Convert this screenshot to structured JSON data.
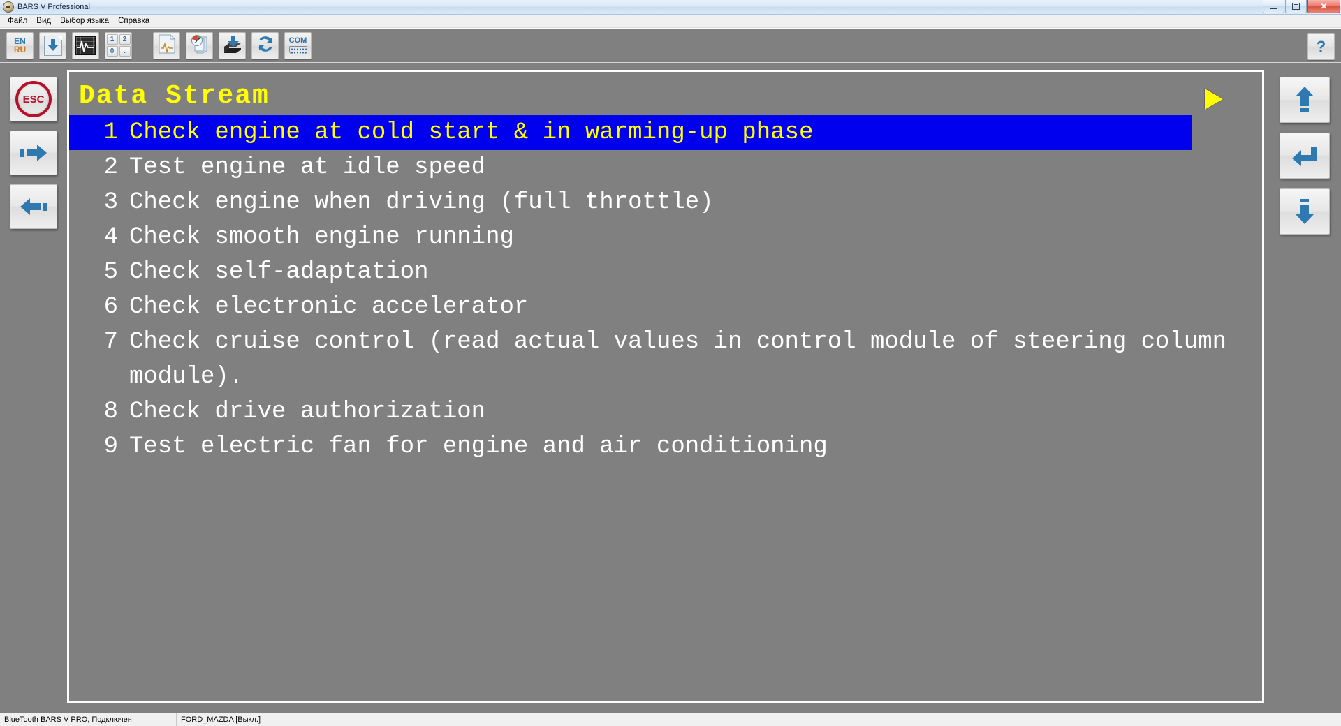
{
  "window": {
    "title": "BARS V Professional",
    "icon": "app-icon",
    "controls": [
      {
        "name": "minimize-button",
        "glyph": "minimize-icon"
      },
      {
        "name": "restore-button",
        "glyph": "restore-icon"
      },
      {
        "name": "close-button",
        "glyph": "close-icon",
        "label": "✕"
      }
    ]
  },
  "menu": {
    "items": [
      {
        "label": "Файл",
        "name": "menu-file"
      },
      {
        "label": "Вид",
        "name": "menu-view"
      },
      {
        "label": "Выбор языка",
        "name": "menu-language"
      },
      {
        "label": "Справка",
        "name": "menu-help"
      }
    ]
  },
  "toolbar": {
    "language_button": {
      "top": "EN",
      "bottom": "RU",
      "name": "language-toggle-button"
    },
    "save_button_name": "save-document-button",
    "oscilloscope_button_name": "oscilloscope-button",
    "numpad_button": {
      "keys": [
        "1",
        "2",
        "0",
        "."
      ],
      "name": "numeric-keypad-button"
    },
    "report_button_name": "report-button",
    "history_button_name": "history-button",
    "download_button_name": "download-firmware-button",
    "refresh_button_name": "refresh-button",
    "com_button": {
      "label": "COM",
      "name": "com-port-button"
    },
    "help_button": {
      "label": "?",
      "name": "help-button"
    }
  },
  "left_sidebar": {
    "items": [
      {
        "name": "esc-button",
        "label": "ESC",
        "icon": "esc-icon"
      },
      {
        "name": "tab-forward-button",
        "icon": "arrow-right-icon"
      },
      {
        "name": "tab-back-button",
        "icon": "arrow-left-icon"
      }
    ]
  },
  "right_sidebar": {
    "items": [
      {
        "name": "scroll-up-button",
        "icon": "arrow-up-icon"
      },
      {
        "name": "enter-button",
        "icon": "enter-arrow-icon"
      },
      {
        "name": "scroll-down-button",
        "icon": "arrow-down-icon"
      }
    ]
  },
  "screen": {
    "title": "Data Stream",
    "marker": "play-triangle-icon",
    "selected_index": 0,
    "items": [
      {
        "num": "1",
        "text": "Check engine at cold start & in warming-up phase",
        "selected": true
      },
      {
        "num": "2",
        "text": "Test engine at idle speed",
        "selected": false
      },
      {
        "num": "3",
        "text": "Check engine when driving (full throttle)",
        "selected": false
      },
      {
        "num": "4",
        "text": "Check smooth engine running",
        "selected": false
      },
      {
        "num": "5",
        "text": "Check self-adaptation",
        "selected": false
      },
      {
        "num": "6",
        "text": "Check electronic accelerator",
        "selected": false
      },
      {
        "num": "7",
        "text": "Check cruise control (read actual values in control module of steering column module).",
        "selected": false
      },
      {
        "num": "8",
        "text": "Check drive authorization",
        "selected": false
      },
      {
        "num": "9",
        "text": "Test electric fan for engine and air conditioning",
        "selected": false
      }
    ],
    "colors": {
      "background": "#808080",
      "text": "#ffffff",
      "title": "#ffff00",
      "selected_background": "#0000ee",
      "selected_text": "#ffff00"
    }
  },
  "statusbar": {
    "connection": "BlueTooth BARS V PRO, Подключен",
    "vehicle": "FORD_MAZDA [Выкл.]",
    "extra": ""
  }
}
